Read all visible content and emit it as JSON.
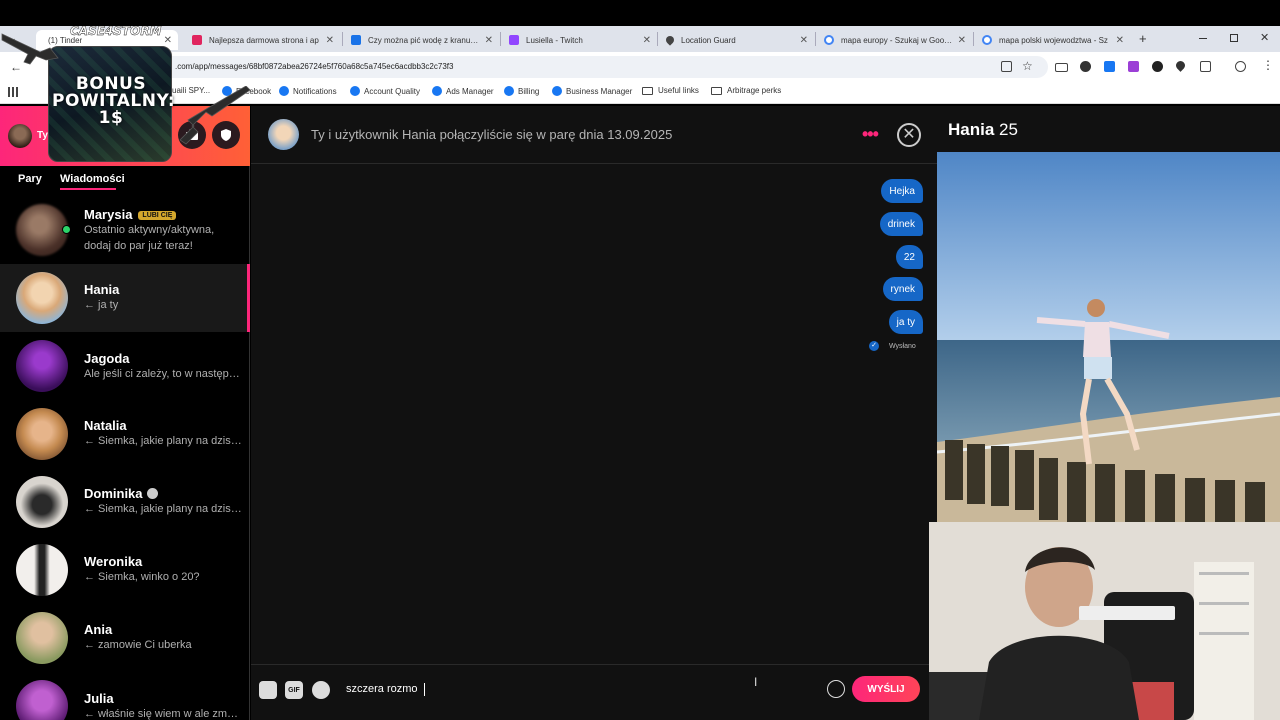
{
  "browser": {
    "tabs": [
      {
        "title": "(1) Tinder",
        "fav": "#fd267a",
        "active": true
      },
      {
        "title": "Najlepsza darmowa strona i ap",
        "fav": "#e0245e"
      },
      {
        "title": "Czy można pić wodę z kranu? C",
        "fav": "#1a73e8"
      },
      {
        "title": "Lusiella - Twitch",
        "fav": "#9146ff"
      },
      {
        "title": "Location Guard",
        "fav": "#444444"
      },
      {
        "title": "mapa europy - Szukaj w Google",
        "fav": "#4285f4"
      },
      {
        "title": "mapa polski wojewodztwa - Sz",
        "fav": "#4285f4"
      }
    ],
    "new_tab_symbol": "+",
    "url": ".com/app/messages/68bf0872abea26724e5f760a68c5a745ec6acdbb3c2c73f3",
    "bookmarks": [
      {
        "label": "uaili SPY...",
        "type": "text"
      },
      {
        "label": "Facebook",
        "type": "fb"
      },
      {
        "label": "Notifications",
        "type": "fb"
      },
      {
        "label": "Account Quality",
        "type": "fb"
      },
      {
        "label": "Ads Manager",
        "type": "fb"
      },
      {
        "label": "Billing",
        "type": "fb"
      },
      {
        "label": "Business Manager",
        "type": "fb"
      },
      {
        "label": "Useful links",
        "type": "folder"
      },
      {
        "label": "Arbitrage perks",
        "type": "folder"
      }
    ]
  },
  "promo": {
    "brand": "CASE4STORM",
    "text": "BONUS POWITALNY: 1$"
  },
  "sidebar": {
    "profile_name": "Ty",
    "tabs": {
      "matches": "Pary",
      "messages": "Wiadomości"
    },
    "conversations": [
      {
        "name": "Marysia",
        "badge": "LUBI CIĘ",
        "message": "Ostatnio aktywny/aktywna, dodaj do par już teraz!",
        "online": true,
        "color": "#5a4036"
      },
      {
        "name": "Hania",
        "message": "← ja ty",
        "active": true,
        "color": "#d9b48f"
      },
      {
        "name": "Jagoda",
        "message": "Ale jeśli ci zależy, to w następnym tygodniu",
        "color": "#4a1a6a"
      },
      {
        "name": "Natalia",
        "message": "← Siemka, jakie plany na dzisiaj?",
        "color": "#c69066"
      },
      {
        "name": "Dominika",
        "message": "← Siemka, jakie plany na dzisiaj?",
        "verified": true,
        "color": "#6b6460"
      },
      {
        "name": "Weronika",
        "message": "← Siemka, winko o 20?",
        "color": "#e8e4e0"
      },
      {
        "name": "Ania",
        "message": "← zamowie Ci uberka",
        "color": "#b89a78"
      },
      {
        "name": "Julia",
        "message": "← właśnie się wiem w ale zmęcz",
        "color": "#8a3aa0"
      }
    ]
  },
  "chat": {
    "header_text": "Ty i użytkownik Hania połączyliście się w parę dnia 13.09.2025",
    "messages": [
      "Hejka",
      "drinek",
      "22",
      "rynek",
      "ja ty"
    ],
    "sent_status": "Wysłano",
    "input_value": "szczera rozmo",
    "gif_label": "GIF",
    "send_label": "WYŚLIJ"
  },
  "profile": {
    "name": "Hania",
    "age": "25"
  },
  "colors": {
    "brand": "#fd267a",
    "bubble": "#1667c7"
  }
}
